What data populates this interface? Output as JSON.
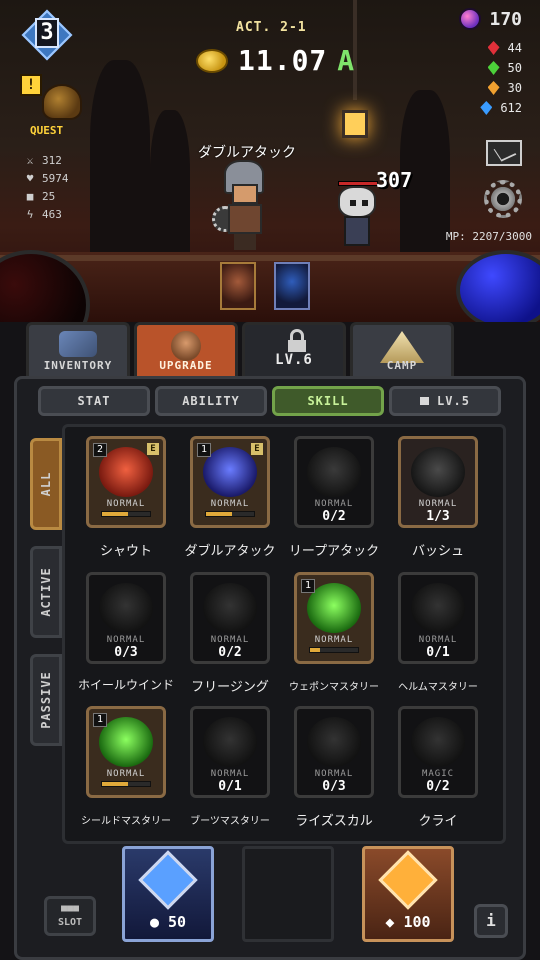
{
  "hud": {
    "player_level": "3",
    "quest_label": "QUEST",
    "stats": {
      "attack": "312",
      "hp": "5974",
      "defense": "25",
      "speed": "463"
    },
    "act_label": "ACT. 2-1",
    "gold_value": "11.07",
    "gold_unit": "A",
    "premium_gems": "170",
    "red_gems": "44",
    "green_gems": "50",
    "orange_gems": "30",
    "blue_gems": "612",
    "mp_text": "MP: 2207/3000"
  },
  "battle": {
    "skill_popup": "ダブルアタック",
    "damage": "307",
    "colors": {
      "hp_orb": "#3a0b0b",
      "mp_orb": "#3f49ff"
    }
  },
  "main_tabs": {
    "inventory": "INVENTORY",
    "upgrade": "UPGRADE",
    "locked": "LV.6",
    "camp": "CAMP"
  },
  "sub_tabs": {
    "stat": "STAT",
    "ability": "ABILITY",
    "skill": "SKILL",
    "locked": "LV.5"
  },
  "side_tabs": {
    "all": "ALL",
    "active": "ACTIVE",
    "passive": "PASSIVE"
  },
  "skills": [
    {
      "name": "シャウト",
      "rarity": "NORMAL",
      "level": "2",
      "equipped_mark": "E",
      "count": "",
      "progress": 0.55
    },
    {
      "name": "ダブルアタック",
      "rarity": "NORMAL",
      "level": "1",
      "equipped_mark": "E",
      "count": "",
      "progress": 0.55
    },
    {
      "name": "リープアタック",
      "rarity": "NORMAL",
      "level": "",
      "equipped_mark": "",
      "count": "0/2"
    },
    {
      "name": "バッシュ",
      "rarity": "NORMAL",
      "level": "",
      "equipped_mark": "",
      "count": "1/3"
    },
    {
      "name": "ホイールウインド",
      "rarity": "NORMAL",
      "level": "",
      "equipped_mark": "",
      "count": "0/3"
    },
    {
      "name": "フリージング",
      "rarity": "NORMAL",
      "level": "",
      "equipped_mark": "",
      "count": "0/2"
    },
    {
      "name": "ウェポンマスタリー",
      "rarity": "NORMAL",
      "level": "1",
      "equipped_mark": "",
      "count": "",
      "progress": 0.2
    },
    {
      "name": "ヘルムマスタリー",
      "rarity": "NORMAL",
      "level": "",
      "equipped_mark": "",
      "count": "0/1"
    },
    {
      "name": "シールドマスタリー",
      "rarity": "NORMAL",
      "level": "1",
      "equipped_mark": "",
      "count": "",
      "progress": 0.55
    },
    {
      "name": "ブーツマスタリー",
      "rarity": "NORMAL",
      "level": "",
      "equipped_mark": "",
      "count": "0/1"
    },
    {
      "name": "ライズスカル",
      "rarity": "NORMAL",
      "level": "",
      "equipped_mark": "",
      "count": "0/3"
    },
    {
      "name": "クライ",
      "rarity": "MAGIC",
      "level": "",
      "equipped_mark": "",
      "count": "0/2"
    }
  ],
  "bottom": {
    "slot_label_top": "■■■",
    "slot_label": "SLOT",
    "blue_summon_cost": "50",
    "gold_summon_cost": "100",
    "info_label": "i"
  }
}
